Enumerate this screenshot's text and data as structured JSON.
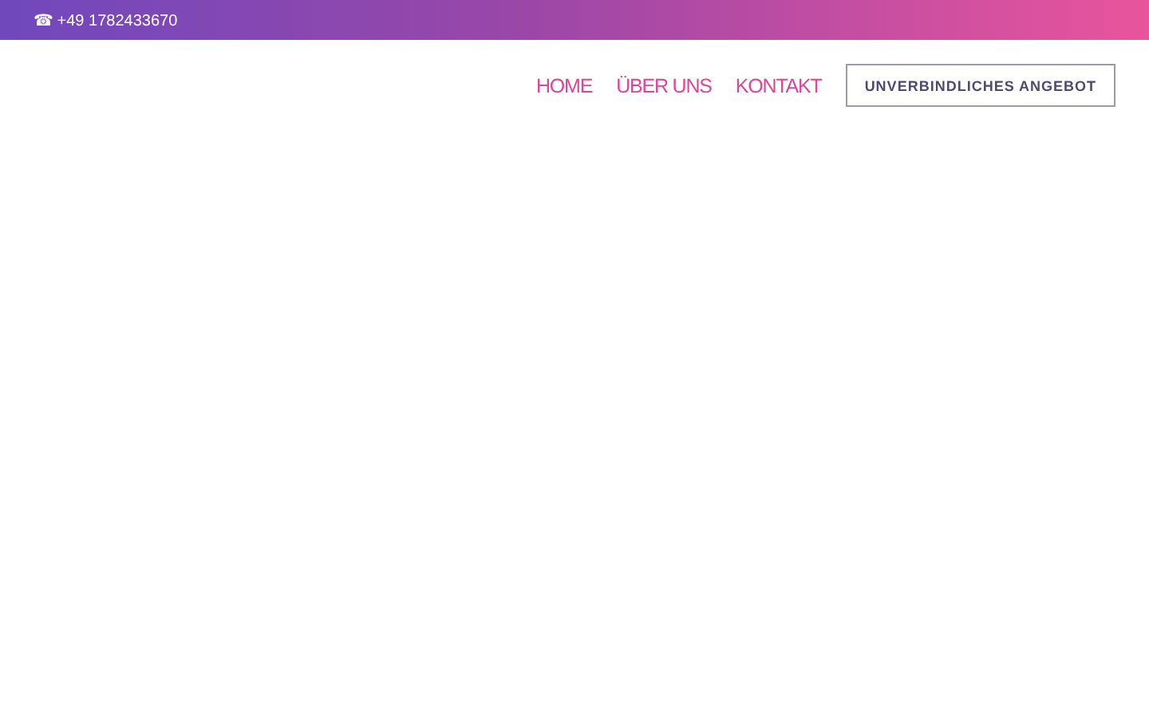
{
  "top_bar": {
    "phone_icon": "☎",
    "phone": "+49 1782433670"
  },
  "nav": {
    "links": [
      "HOME",
      "ÜBER UNS",
      "KONTAKT"
    ],
    "cta_button": "UNVERBINDLICHES ANGEBOT"
  }
}
